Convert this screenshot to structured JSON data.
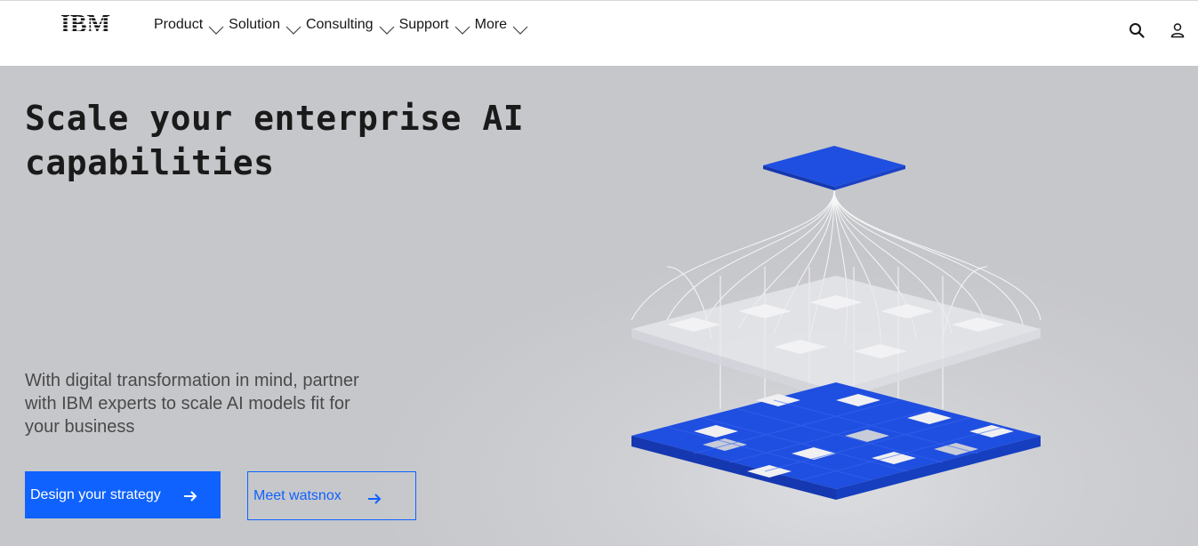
{
  "header": {
    "logo_text": "IBM",
    "nav": [
      {
        "label": "Product"
      },
      {
        "label": "Solution"
      },
      {
        "label": "Consulting"
      },
      {
        "label": "Support"
      },
      {
        "label": "More"
      }
    ],
    "icons": [
      "search-icon",
      "user-icon"
    ]
  },
  "hero": {
    "headline": "Scale your enterprise AI capabilities",
    "subtext": "With digital transformation in mind, partner with IBM experts to scale AI models fit for your business",
    "primary_cta": "Design your strategy",
    "secondary_cta": "Meet watsnox",
    "illustration": "ai-network-cubes-illustration"
  },
  "colors": {
    "accent": "#0f62fe",
    "hero_bg": "#c6c7cb",
    "header_bg": "#ffffff",
    "text": "#161616"
  }
}
